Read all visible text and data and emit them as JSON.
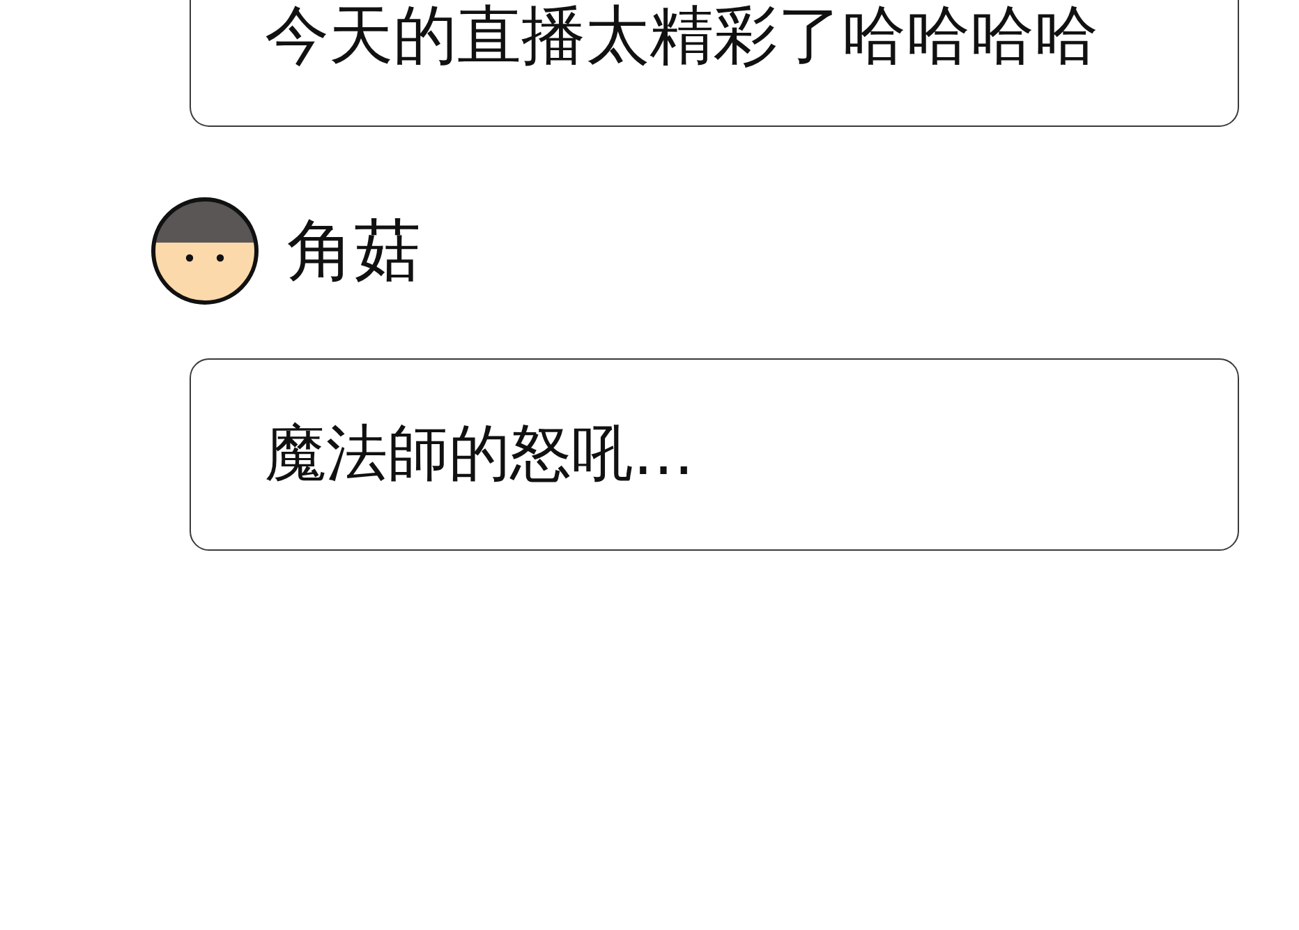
{
  "messages": [
    {
      "text": "今天的直播太精彩了哈哈哈哈"
    },
    {
      "author": "角菇",
      "text": "魔法師的怒吼…"
    }
  ]
}
